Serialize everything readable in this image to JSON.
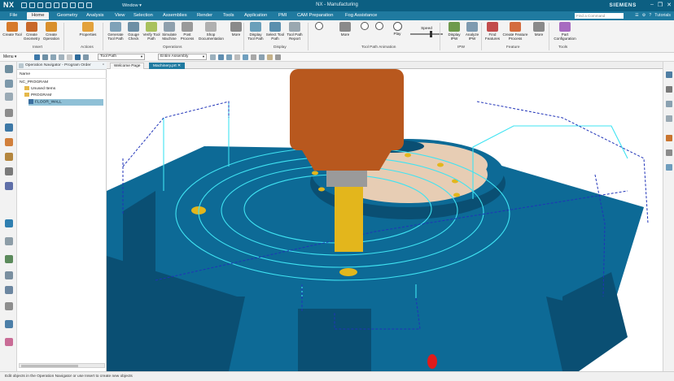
{
  "titlebar": {
    "logo": "NX",
    "window_menu": "Window ▾",
    "app_title": "NX - Manufacturing",
    "brand": "SIEMENS",
    "win_buttons": [
      "–",
      "❐",
      "✕"
    ]
  },
  "menu": {
    "tabs": [
      "File",
      "Home",
      "Geometry",
      "Analysis",
      "View",
      "Selection",
      "Assemblies",
      "Render",
      "Tools",
      "Application",
      "PMI",
      "CAM Preparation",
      "Fog Assistance"
    ],
    "active_tab": "Home",
    "find_placeholder": "Find a Command",
    "right_items": [
      "☰",
      "⚙",
      "?",
      "Tutorials"
    ]
  },
  "ribbon": {
    "buttons": [
      {
        "label": "Create Tool",
        "icon": "create-tool-icon",
        "color": "#d77a2a"
      },
      {
        "label": "Create Geometry",
        "icon": "create-geometry-icon",
        "color": "#c8682a"
      },
      {
        "label": "Create Operation",
        "icon": "create-operation-icon",
        "color": "#d9902d"
      },
      {
        "label": "Properties",
        "icon": "properties-icon",
        "color": "#e3a23c"
      },
      {
        "label": "Generate Tool Path",
        "icon": "generate-tool-path-icon",
        "color": "#7fa2b8"
      },
      {
        "label": "Gouge Check",
        "icon": "gouge-check-icon",
        "color": "#6d8fa5"
      },
      {
        "label": "Verify Tool Path",
        "icon": "verify-tool-path-icon",
        "color": "#a9c15d"
      },
      {
        "label": "Simulate Machine",
        "icon": "simulate-machine-icon",
        "color": "#8fa0ad"
      },
      {
        "label": "Post Process",
        "icon": "post-process-icon",
        "color": "#9a9a9a"
      },
      {
        "label": "Shop Documentation",
        "icon": "shop-documentation-icon",
        "color": "#b0b0b0"
      },
      {
        "label": "More",
        "icon": "more-icon",
        "color": "#8a8a8a"
      },
      {
        "label": "Display Tool Path",
        "icon": "display-tool-path-icon",
        "color": "#6b9fba"
      },
      {
        "label": "Select Tool Path",
        "icon": "select-tool-path-icon",
        "color": "#5b8fae"
      },
      {
        "label": "Tool Path Report",
        "icon": "tool-path-report-icon",
        "color": "#9aa7b0"
      },
      {
        "label": "More",
        "icon": "more-icon",
        "color": "#8a8a8a"
      },
      {
        "label": "Play",
        "icon": "play-icon",
        "color": "#ffffff"
      },
      {
        "label": "Display IPW",
        "icon": "display-ipw-icon",
        "color": "#6e9a4c"
      },
      {
        "label": "Analyze IPW",
        "icon": "analyze-ipw-icon",
        "color": "#7e9ab0"
      },
      {
        "label": "Find Features",
        "icon": "find-features-icon",
        "color": "#c24c4c"
      },
      {
        "label": "Create Feature Process",
        "icon": "create-feature-process-icon",
        "color": "#d46c3e"
      },
      {
        "label": "More",
        "icon": "more-icon",
        "color": "#8a8a8a"
      },
      {
        "label": "Part Configuration",
        "icon": "part-configuration-icon",
        "color": "#a76bc0"
      }
    ],
    "speed_label": "Speed",
    "speed_level": 0.6,
    "groups": [
      "Insert",
      "Actions",
      "Operations",
      "Display",
      "Tool Path Animation",
      "IPW",
      "Feature",
      "Tools"
    ]
  },
  "selectionbar": {
    "menu_label": "Menu ▾",
    "filter_value": "Tool Path",
    "scope_value": "Entire Assembly"
  },
  "navigator": {
    "title": "Operation Navigator - Program Order",
    "column": "Name",
    "rows": [
      {
        "label": "NC_PROGRAM",
        "type": "root"
      },
      {
        "label": "Unused Items",
        "type": "folder"
      },
      {
        "label": "PROGRAM",
        "type": "folder"
      },
      {
        "label": "FLOOR_WALL",
        "type": "operation"
      }
    ]
  },
  "doc_tabs": {
    "tabs": [
      "Welcome Page",
      "Machinery.prt"
    ],
    "active": "Machinery.prt"
  },
  "viewport": {
    "colors": {
      "part": "#0d6a96",
      "part_dark": "#0a4f73",
      "tool_holder": "#b8581e",
      "tool_shank": "#9a9a9a",
      "cutter": "#e3b61c",
      "tool_path": "#3fe3f2",
      "rapid_path": "#2033b8",
      "bore": "#e7cdb4"
    }
  },
  "status": {
    "message": "Edit objects in the Operation Navigator or use Insert to create new objects"
  }
}
